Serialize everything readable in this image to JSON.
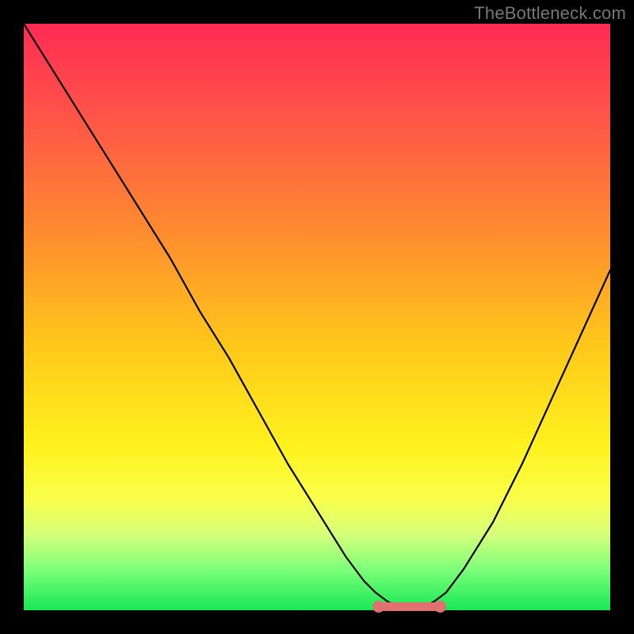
{
  "watermark": "TheBottleneck.com",
  "colors": {
    "curve": "#000000",
    "marker": "#e17070",
    "frame_bg": "#000000"
  },
  "chart_data": {
    "type": "line",
    "title": "",
    "xlabel": "",
    "ylabel": "",
    "xlim": [
      0,
      100
    ],
    "ylim": [
      0,
      100
    ],
    "grid": false,
    "series": [
      {
        "name": "curve",
        "x": [
          0,
          5,
          10,
          15,
          20,
          25,
          30,
          35,
          40,
          45,
          50,
          55,
          58,
          60,
          62,
          64,
          66,
          68,
          70,
          72,
          75,
          80,
          85,
          90,
          95,
          100
        ],
        "values": [
          100,
          92,
          84,
          76,
          68,
          60,
          51,
          43,
          34,
          25,
          17,
          9,
          5,
          3,
          1.5,
          0.5,
          0.5,
          0.5,
          1.5,
          3,
          7,
          15,
          25,
          36,
          47,
          58
        ]
      }
    ],
    "annotations": [
      {
        "name": "bottom-marker",
        "type": "segment",
        "x": [
          60.5,
          71
        ],
        "y": [
          0.6,
          0.6
        ],
        "color": "#e17070",
        "end_dots": true
      }
    ]
  }
}
